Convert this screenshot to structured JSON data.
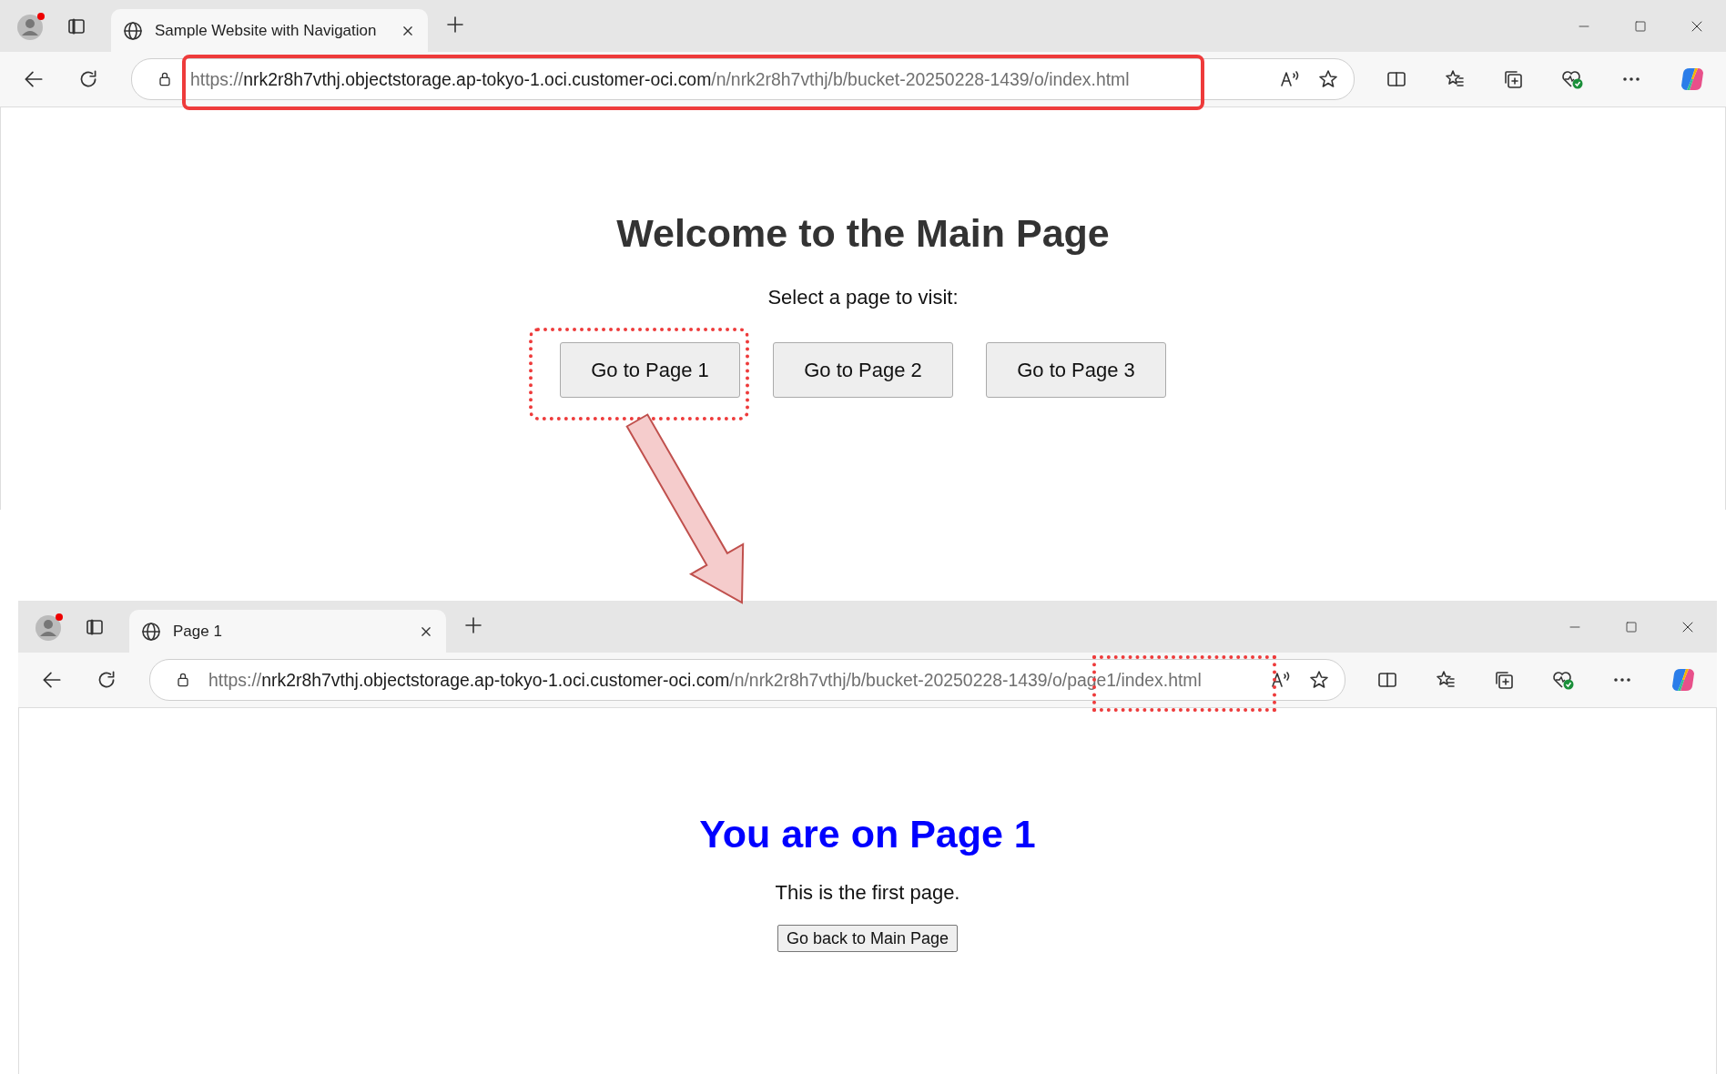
{
  "windows": [
    {
      "tab": {
        "title": "Sample Website with Navigation"
      },
      "url": {
        "scheme": "https://",
        "host": "nrk2r8h7vthj.objectstorage.ap-tokyo-1.oci.customer-oci.com",
        "path": "/n/nrk2r8h7vthj/b/bucket-20250228-1439/o/index.html"
      },
      "page": {
        "kind": "main",
        "heading": "Welcome to the Main Page",
        "text": "Select a page to visit:",
        "buttons": [
          "Go to Page 1",
          "Go to Page 2",
          "Go to Page 3"
        ]
      }
    },
    {
      "tab": {
        "title": "Page 1"
      },
      "url": {
        "scheme": "https://",
        "host": "nrk2r8h7vthj.objectstorage.ap-tokyo-1.oci.customer-oci.com",
        "path": "/n/nrk2r8h7vthj/b/bucket-20250228-1439/o/page1/index.html"
      },
      "page": {
        "kind": "sub",
        "heading": "You are on Page 1",
        "text": "This is the first page.",
        "buttons": [
          "Go back to Main Page"
        ]
      }
    }
  ]
}
